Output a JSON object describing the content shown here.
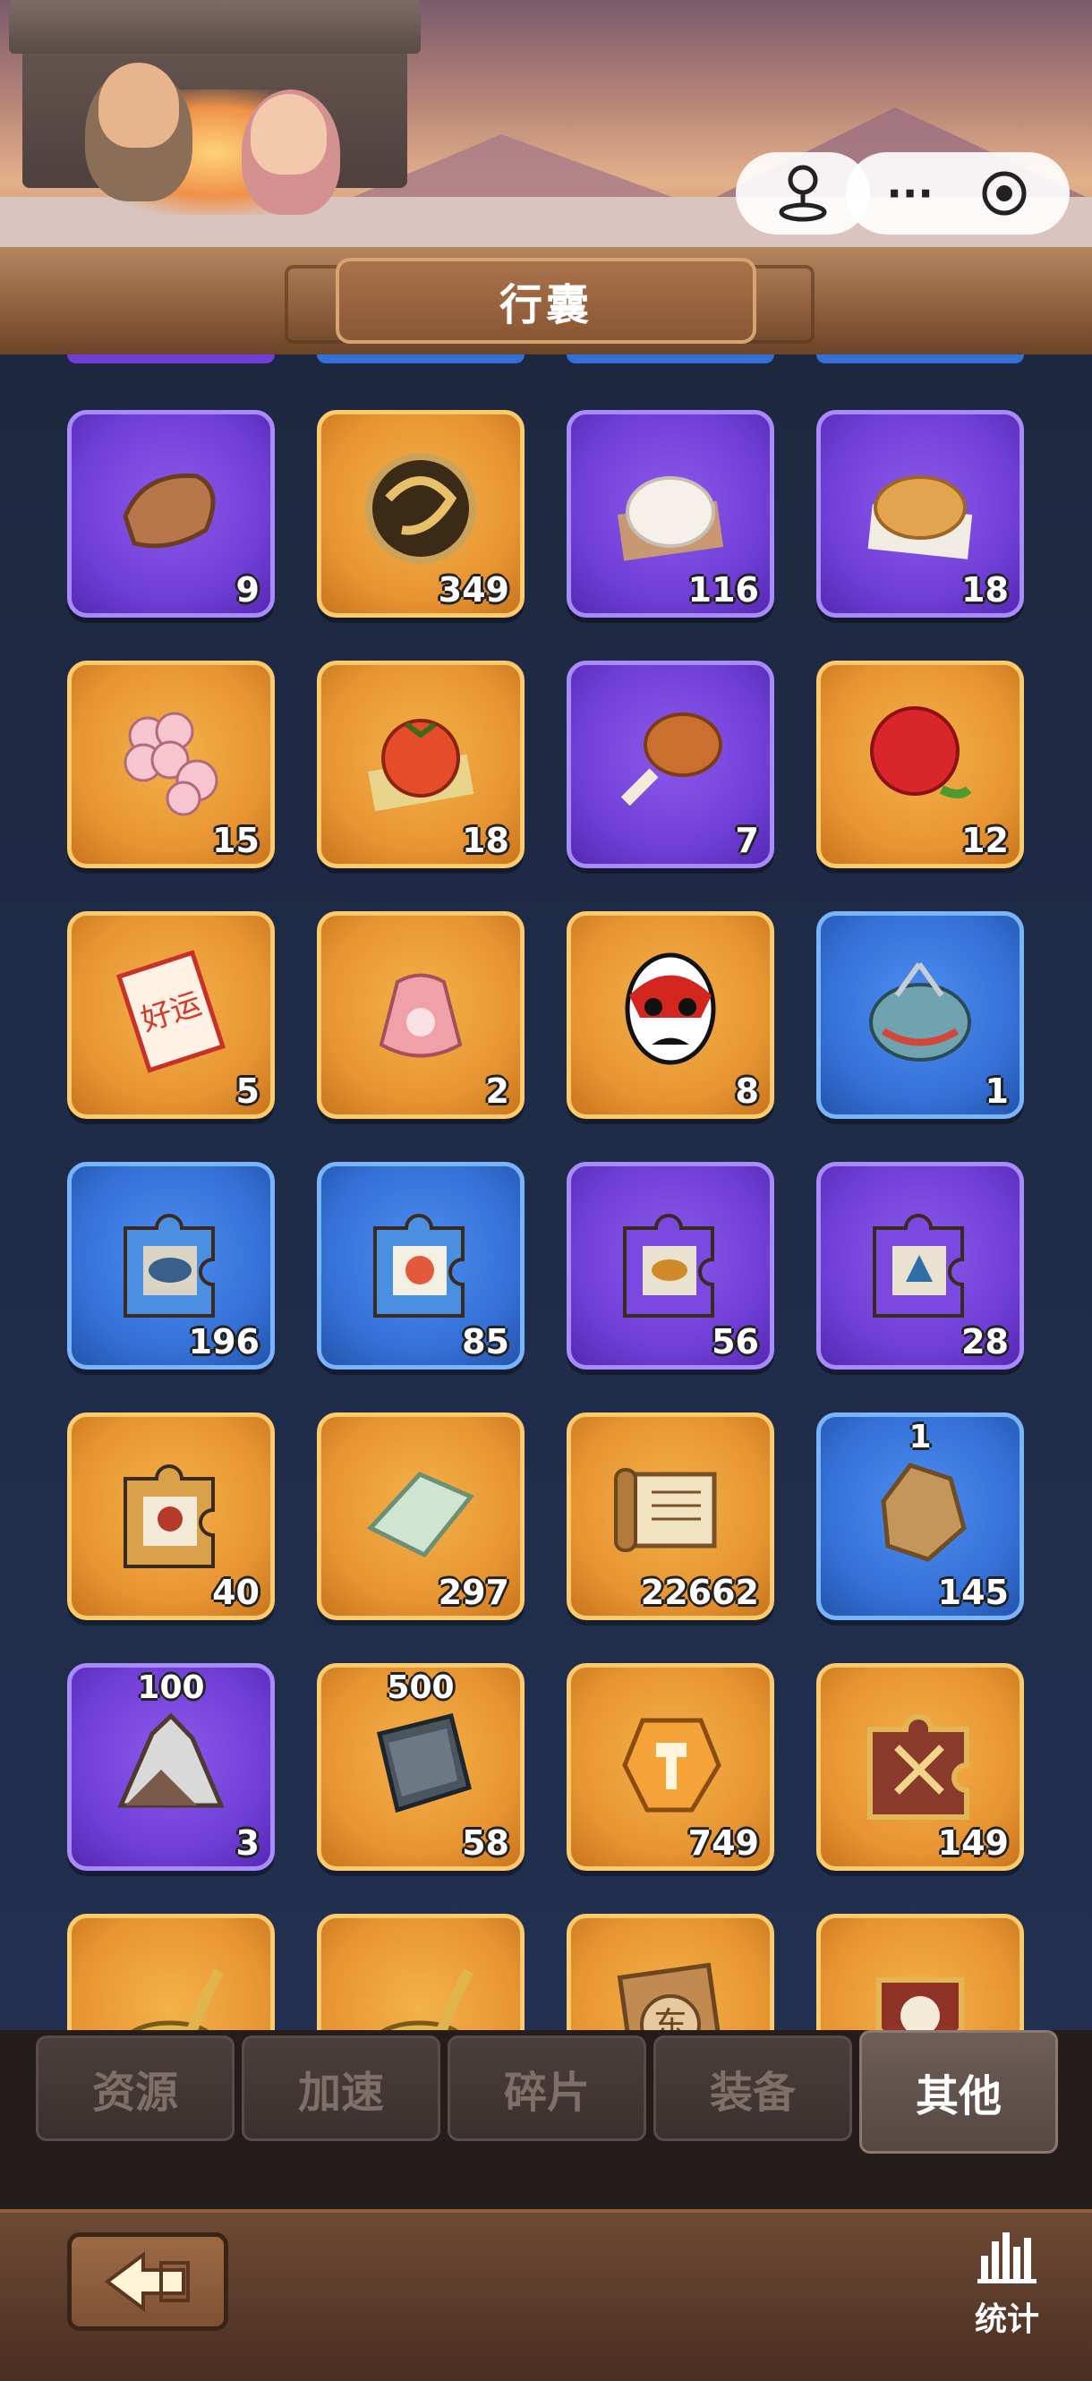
{
  "title": "行囊",
  "capsule_icons": [
    "joystick-icon",
    "more-dots-icon",
    "record-target-icon"
  ],
  "capsule_more_glyph": "···",
  "items": [
    {
      "name": "dough-scrap",
      "rarity": "purple",
      "count": "9"
    },
    {
      "name": "gold-dragon-orb",
      "rarity": "orange",
      "count": "349"
    },
    {
      "name": "steamed-bun",
      "rarity": "purple",
      "count": "116"
    },
    {
      "name": "pastry-cake",
      "rarity": "purple",
      "count": "18"
    },
    {
      "name": "plum-blossom",
      "rarity": "orange",
      "count": "15"
    },
    {
      "name": "persimmon",
      "rarity": "orange",
      "count": "18"
    },
    {
      "name": "chicken-leg",
      "rarity": "purple",
      "count": "7"
    },
    {
      "name": "rose",
      "rarity": "orange",
      "count": "12"
    },
    {
      "name": "good-luck-envelope",
      "rarity": "orange",
      "count": "5",
      "label": "好运"
    },
    {
      "name": "pink-pouch",
      "rarity": "orange",
      "count": "2"
    },
    {
      "name": "opera-mask",
      "rarity": "orange",
      "count": "8"
    },
    {
      "name": "sewing-bag",
      "rarity": "blue",
      "count": "1"
    },
    {
      "name": "kite-fish-puzzle",
      "rarity": "blue",
      "count": "196"
    },
    {
      "name": "bird-puzzle",
      "rarity": "blue",
      "count": "85"
    },
    {
      "name": "goldfish-puzzle",
      "rarity": "purple",
      "count": "56"
    },
    {
      "name": "peacock-puzzle",
      "rarity": "purple",
      "count": "28"
    },
    {
      "name": "painting-puzzle",
      "rarity": "orange",
      "count": "40"
    },
    {
      "name": "jade-slab",
      "rarity": "orange",
      "count": "297"
    },
    {
      "name": "scroll-book",
      "rarity": "orange",
      "count": "22662"
    },
    {
      "name": "rock-ore",
      "rarity": "blue",
      "count": "145",
      "top": "1"
    },
    {
      "name": "silver-mountain-ore",
      "rarity": "purple",
      "count": "3",
      "top": "100"
    },
    {
      "name": "iron-plate",
      "rarity": "orange",
      "count": "58",
      "top": "500"
    },
    {
      "name": "hammer-crystal",
      "rarity": "orange",
      "count": "749"
    },
    {
      "name": "crossed-swords-puzzle",
      "rarity": "orange",
      "count": "149"
    },
    {
      "name": "gold-spoon",
      "rarity": "orange",
      "count": ""
    },
    {
      "name": "gold-spoon-2",
      "rarity": "orange",
      "count": ""
    },
    {
      "name": "east-token",
      "rarity": "orange",
      "count": "",
      "label": "东"
    },
    {
      "name": "cloud-badge",
      "rarity": "orange",
      "count": ""
    }
  ],
  "peek_colors": [
    "#6f3ed6",
    "#3470d6",
    "#3470d6",
    "#3470d6"
  ],
  "tabs": [
    {
      "label": "资源",
      "active": false
    },
    {
      "label": "加速",
      "active": false
    },
    {
      "label": "碎片",
      "active": false
    },
    {
      "label": "装备",
      "active": false
    },
    {
      "label": "其他",
      "active": true
    }
  ],
  "bottom": {
    "stats_label": "统计"
  },
  "colors": {
    "orange": "#e79432",
    "purple": "#6f3ed6",
    "blue": "#3470d6"
  }
}
